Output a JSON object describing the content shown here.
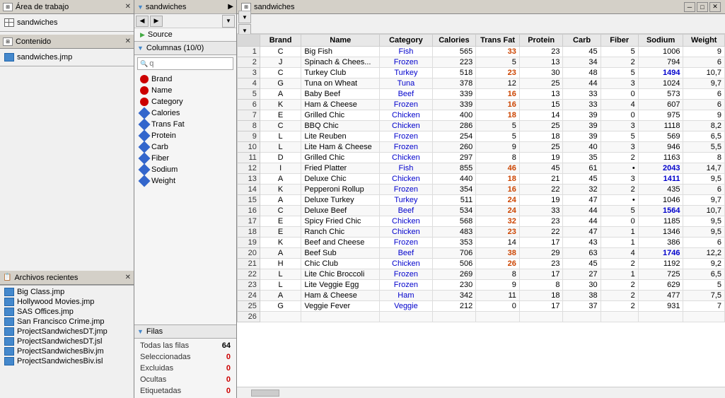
{
  "app": {
    "title": "sandwiches",
    "workspace_label": "Área de trabajo",
    "content_label": "Contenido",
    "recent_label": "Archivos recientes",
    "sandwiches_file": "sandwiches.jmp"
  },
  "left_panel": {
    "workspace_items": [
      {
        "label": "sandwiches",
        "type": "table"
      }
    ],
    "content_items": [
      {
        "label": "sandwiches.jmp",
        "type": "jmp"
      }
    ],
    "recent_files": [
      {
        "label": "Big Class.jmp"
      },
      {
        "label": "Hollywood Movies.jmp"
      },
      {
        "label": "SAS Offices.jmp"
      },
      {
        "label": "San Francisco Crime.jmp"
      },
      {
        "label": "ProjectSandwichesDT.jmp"
      },
      {
        "label": "ProjectSandwichesDT.jsl"
      },
      {
        "label": "ProjectSandwichesBiv.jm"
      },
      {
        "label": "ProjectSandwichesBiv.isl"
      }
    ]
  },
  "mid_panel": {
    "title": "sandwiches",
    "source_label": "Source",
    "columns_label": "Columnas (10/0)",
    "search_placeholder": "q",
    "columns": [
      {
        "label": "Brand",
        "type": "nominal"
      },
      {
        "label": "Name",
        "type": "nominal"
      },
      {
        "label": "Category",
        "type": "nominal"
      },
      {
        "label": "Calories",
        "type": "continuous"
      },
      {
        "label": "Trans Fat",
        "type": "continuous"
      },
      {
        "label": "Protein",
        "type": "continuous"
      },
      {
        "label": "Carb",
        "type": "continuous"
      },
      {
        "label": "Fiber",
        "type": "continuous"
      },
      {
        "label": "Sodium",
        "type": "continuous"
      },
      {
        "label": "Weight",
        "type": "continuous"
      }
    ],
    "rows_label": "Filas",
    "rows_stats": [
      {
        "label": "Todas las filas",
        "value": "64",
        "highlight": false
      },
      {
        "label": "Seleccionadas",
        "value": "0",
        "highlight": true
      },
      {
        "label": "Excluidas",
        "value": "0",
        "highlight": true
      },
      {
        "label": "Ocultas",
        "value": "0",
        "highlight": true
      },
      {
        "label": "Etiquetadas",
        "value": "0",
        "highlight": true
      }
    ]
  },
  "table": {
    "columns": [
      "Brand",
      "Name",
      "Category",
      "Calories",
      "Trans Fat",
      "Protein",
      "Carb",
      "Fiber",
      "Sodium",
      "Weight"
    ],
    "rows": [
      [
        1,
        "C",
        "Big Fish",
        "Fish",
        565,
        33,
        23,
        45,
        5,
        1006,
        9
      ],
      [
        2,
        "J",
        "Spinach & Chees...",
        "Frozen",
        223,
        5,
        13,
        34,
        2,
        794,
        6
      ],
      [
        3,
        "C",
        "Turkey Club",
        "Turkey",
        518,
        23,
        30,
        48,
        5,
        1494,
        "10,7"
      ],
      [
        4,
        "G",
        "Tuna on Wheat",
        "Tuna",
        378,
        12,
        25,
        44,
        3,
        1024,
        "9,7"
      ],
      [
        5,
        "A",
        "Baby Beef",
        "Beef",
        339,
        16,
        13,
        33,
        0,
        573,
        6
      ],
      [
        6,
        "K",
        "Ham & Cheese",
        "Frozen",
        339,
        16,
        15,
        33,
        4,
        607,
        6
      ],
      [
        7,
        "E",
        "Grilled Chic",
        "Chicken",
        400,
        18,
        14,
        39,
        0,
        975,
        9
      ],
      [
        8,
        "C",
        "BBQ Chic",
        "Chicken",
        286,
        5,
        25,
        39,
        3,
        1118,
        "8,2"
      ],
      [
        9,
        "L",
        "Lite Reuben",
        "Frozen",
        254,
        5,
        18,
        39,
        5,
        569,
        "6,5"
      ],
      [
        10,
        "L",
        "Lite Ham & Cheese",
        "Frozen",
        260,
        9,
        25,
        40,
        3,
        946,
        "5,5"
      ],
      [
        11,
        "D",
        "Grilled Chic",
        "Chicken",
        297,
        8,
        19,
        35,
        2,
        1163,
        8
      ],
      [
        12,
        "I",
        "Fried Platter",
        "Fish",
        855,
        46,
        45,
        61,
        "•",
        2043,
        "14,7"
      ],
      [
        13,
        "A",
        "Deluxe Chic",
        "Chicken",
        440,
        18,
        21,
        45,
        3,
        1411,
        "9,5"
      ],
      [
        14,
        "K",
        "Pepperoni Rollup",
        "Frozen",
        354,
        16,
        22,
        32,
        2,
        435,
        6
      ],
      [
        15,
        "A",
        "Deluxe Turkey",
        "Turkey",
        511,
        24,
        19,
        47,
        "•",
        1046,
        "9,7"
      ],
      [
        16,
        "C",
        "Deluxe Beef",
        "Beef",
        534,
        24,
        33,
        44,
        5,
        1564,
        "10,7"
      ],
      [
        17,
        "E",
        "Spicy Fried Chic",
        "Chicken",
        568,
        32,
        23,
        44,
        0,
        1185,
        "9,5"
      ],
      [
        18,
        "E",
        "Ranch Chic",
        "Chicken",
        483,
        23,
        22,
        47,
        1,
        1346,
        "9,5"
      ],
      [
        19,
        "K",
        "Beef and Cheese",
        "Frozen",
        353,
        14,
        17,
        43,
        1,
        386,
        6
      ],
      [
        20,
        "A",
        "Beef Sub",
        "Beef",
        706,
        38,
        29,
        63,
        4,
        1746,
        "12,2"
      ],
      [
        21,
        "H",
        "Chic Club",
        "Chicken",
        506,
        26,
        23,
        45,
        2,
        1192,
        "9,2"
      ],
      [
        22,
        "L",
        "Lite Chic Broccoli",
        "Frozen",
        269,
        8,
        17,
        27,
        1,
        725,
        "6,5"
      ],
      [
        23,
        "L",
        "Lite Veggie Egg",
        "Frozen",
        230,
        9,
        8,
        30,
        2,
        629,
        5
      ],
      [
        24,
        "A",
        "Ham & Cheese",
        "Ham",
        342,
        11,
        18,
        38,
        2,
        477,
        "7,5"
      ],
      [
        25,
        "G",
        "Veggie Fever",
        "Veggie",
        212,
        0,
        17,
        37,
        2,
        931,
        7
      ],
      [
        26,
        "",
        "",
        "",
        "",
        "",
        "",
        "",
        "",
        "",
        ""
      ]
    ]
  }
}
